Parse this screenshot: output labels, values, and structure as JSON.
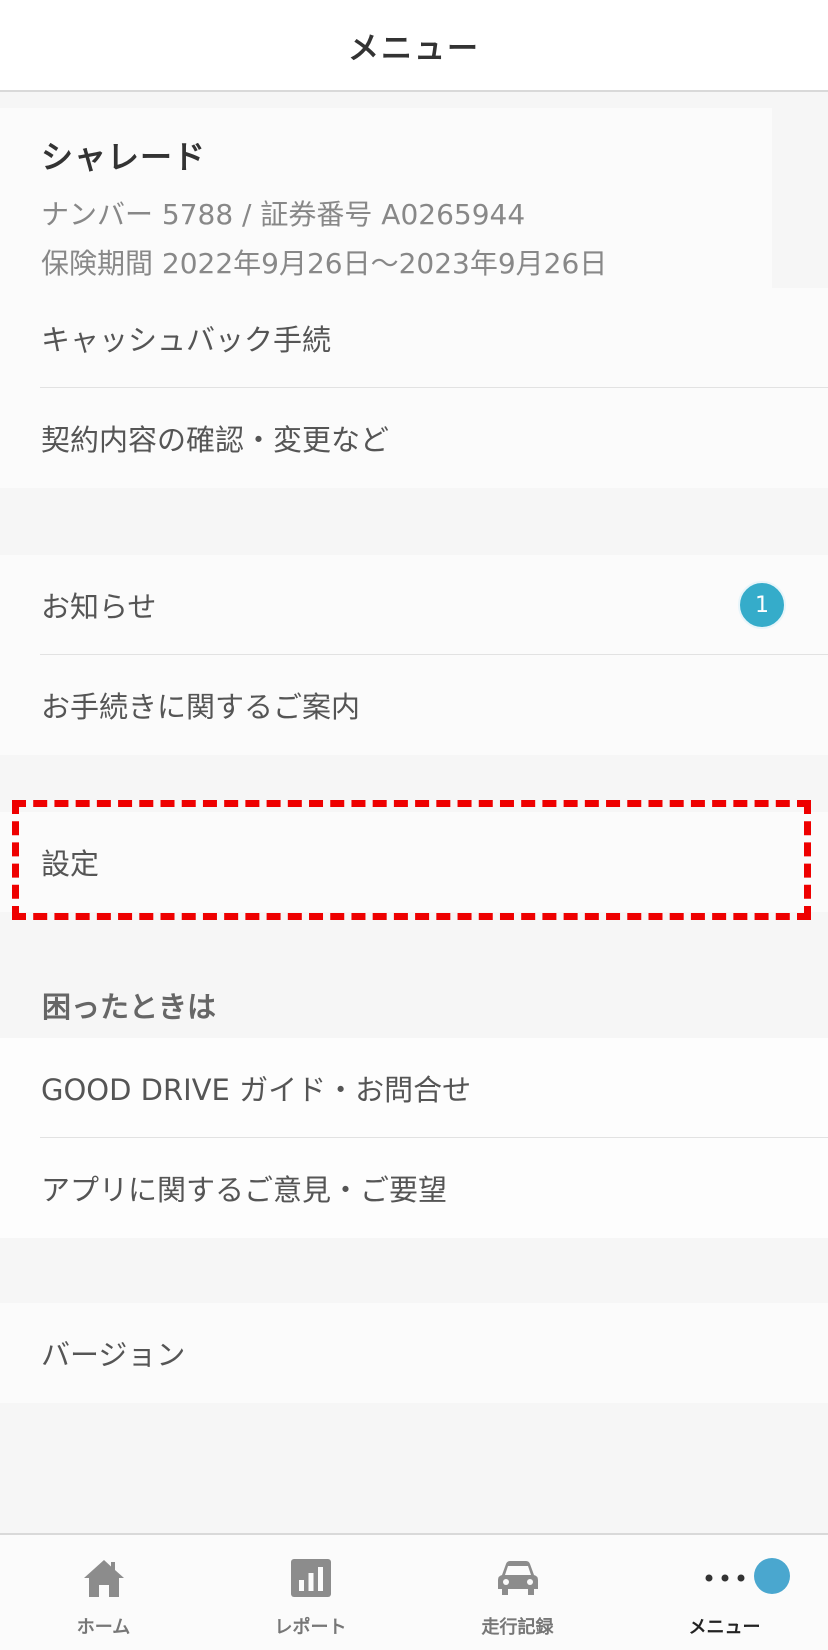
{
  "header": {
    "title": "メニュー"
  },
  "vehicle": {
    "name": "シャレード",
    "number_line": "ナンバー 5788 / 証券番号 A0265944",
    "period_line": "保険期間 2022年9月26日〜2023年9月26日"
  },
  "contract_menu": [
    {
      "label": "キャッシュバック手続"
    },
    {
      "label": "契約内容の確認・変更など"
    }
  ],
  "info_menu": [
    {
      "label": "お知らせ",
      "badge": "1"
    },
    {
      "label": "お手続きに関するご案内"
    }
  ],
  "settings": {
    "label": "設定"
  },
  "help": {
    "heading": "困ったときは",
    "items": [
      {
        "label": "GOOD DRIVE ガイド・お問合せ"
      },
      {
        "label": "アプリに関するご意見・ご要望"
      }
    ]
  },
  "version": {
    "label": "バージョン"
  },
  "tabbar": {
    "tabs": [
      {
        "label": "ホーム",
        "icon": "home-icon"
      },
      {
        "label": "レポート",
        "icon": "report-icon"
      },
      {
        "label": "走行記録",
        "icon": "car-icon"
      },
      {
        "label": "メニュー",
        "icon": "more-icon",
        "active": true
      }
    ]
  },
  "colors": {
    "badge": "#35acca",
    "highlight": "#ee0000",
    "notification_dot": "#4aa7cf"
  }
}
